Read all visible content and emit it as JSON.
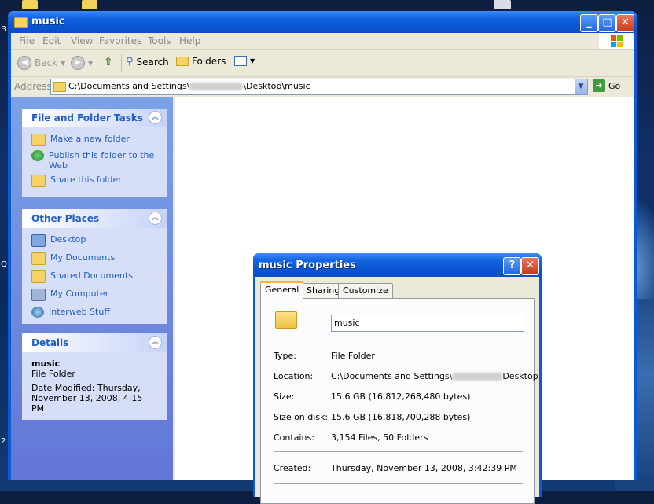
{
  "desktop": {
    "edge_letters": [
      "B",
      "Q",
      "2"
    ]
  },
  "window": {
    "title": "music",
    "controls": {
      "minimize": "_",
      "maximize": "□",
      "close": "✕"
    }
  },
  "menubar": {
    "items": [
      "File",
      "Edit",
      "View",
      "Favorites",
      "Tools",
      "Help"
    ]
  },
  "toolbar": {
    "back": "Back",
    "forward": "",
    "search": "Search",
    "folders": "Folders"
  },
  "address": {
    "label": "Address",
    "path_prefix": "C:\\Documents and Settings\\",
    "path_suffix": "\\Desktop\\music",
    "go": "Go"
  },
  "sidebar": {
    "tasks": {
      "title": "File and Folder Tasks",
      "items": [
        "Make a new folder",
        "Publish this folder to the Web",
        "Share this folder"
      ]
    },
    "places": {
      "title": "Other Places",
      "items": [
        "Desktop",
        "My Documents",
        "Shared Documents",
        "My Computer",
        "Interweb Stuff"
      ]
    },
    "details": {
      "title": "Details",
      "name": "music",
      "type": "File Folder",
      "modified": "Date Modified: Thursday, November 13, 2008, 4:15 PM"
    }
  },
  "dialog": {
    "title": "music Properties",
    "help": "?",
    "close": "✕",
    "tabs": [
      "General",
      "Sharing",
      "Customize"
    ],
    "name": "music",
    "rows": [
      {
        "label": "Type:",
        "value": "File Folder"
      },
      {
        "label": "Location:",
        "value_prefix": "C:\\Documents and Settings\\",
        "value_suffix": "Desktop"
      },
      {
        "label": "Size:",
        "value": "15.6 GB (16,812,268,480 bytes)"
      },
      {
        "label": "Size on disk:",
        "value": "15.6 GB (16,818,700,288 bytes)"
      },
      {
        "label": "Contains:",
        "value": "3,154 Files, 50 Folders"
      },
      {
        "label": "Created:",
        "value": "Thursday, November 13, 2008, 3:42:39 PM"
      }
    ]
  },
  "colors": {
    "titlebar": "#0a55d4",
    "link": "#215dc6",
    "sidebar_top": "#7ba2e7",
    "sidebar_bottom": "#6375d6"
  }
}
